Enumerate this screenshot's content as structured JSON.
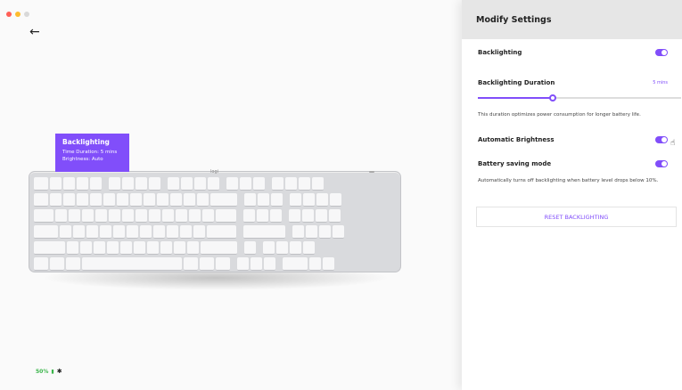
{
  "colors": {
    "accent": "#814efa",
    "battery_green": "#3ab54a"
  },
  "window": {
    "traffic_lights": [
      "#ff5f57",
      "#febc2e",
      "#d9d9d9"
    ]
  },
  "icons": {
    "back": "←",
    "battery": "▮",
    "bluetooth": "✱",
    "cursor": "☝"
  },
  "tooltip": {
    "title": "Backlighting",
    "duration": "Time Duration: 5 mins",
    "brightness": "Brightness: Auto"
  },
  "keyboard": {
    "logo": "logi"
  },
  "status": {
    "battery_percent": "50%"
  },
  "panel": {
    "title": "Modify Settings",
    "backlighting": {
      "label": "Backlighting",
      "on": true
    },
    "duration": {
      "label": "Backlighting Duration",
      "value": "5 mins",
      "slider_fraction": 0.37,
      "description": "This duration optimizes power consumption for longer battery life."
    },
    "auto_brightness": {
      "label": "Automatic Brightness",
      "on": true
    },
    "battery_saving": {
      "label": "Battery saving mode",
      "on": true,
      "description": "Automatically turns off backlighting when battery level drops below 10%."
    },
    "reset_label": "RESET BACKLIGHTING"
  }
}
